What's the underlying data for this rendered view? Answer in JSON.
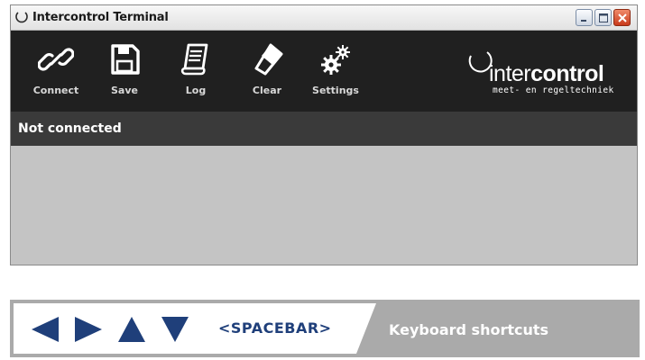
{
  "window": {
    "title": "Intercontrol Terminal",
    "controls": [
      "minimize",
      "maximize",
      "close"
    ]
  },
  "toolbar": {
    "items": [
      {
        "label": "Connect",
        "icon": "link-icon"
      },
      {
        "label": "Save",
        "icon": "floppy-disk-icon"
      },
      {
        "label": "Log",
        "icon": "log-document-icon"
      },
      {
        "label": "Clear",
        "icon": "eraser-icon"
      },
      {
        "label": "Settings",
        "icon": "gears-icon"
      }
    ]
  },
  "logo": {
    "name_light": "inter",
    "name_bold": "control",
    "tagline": "meet- en regeltechniek"
  },
  "status": {
    "text": "Not connected"
  },
  "shortcuts": {
    "keys": [
      "left-arrow-icon",
      "right-arrow-icon",
      "up-arrow-icon",
      "down-arrow-icon"
    ],
    "spacebar": "<SPACEBAR>",
    "label": "Keyboard shortcuts"
  },
  "colors": {
    "toolbar_bg": "#202020",
    "status_bg": "#3a3a3a",
    "content_bg": "#c4c4c4",
    "accent_blue": "#1f3f7a",
    "shortcut_gray": "#aaaaaa"
  }
}
